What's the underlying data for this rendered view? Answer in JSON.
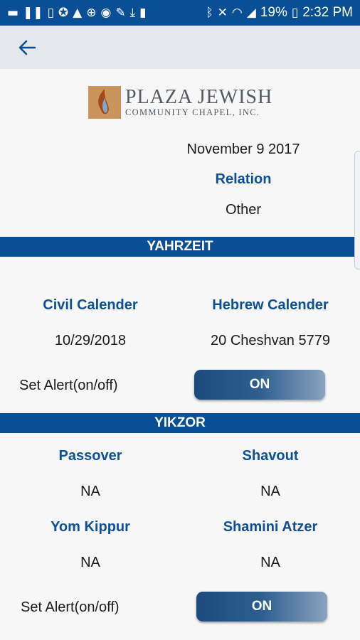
{
  "status_bar": {
    "battery": "19%",
    "time": "2:32 PM"
  },
  "logo": {
    "line1": "PLAZA JEWISH",
    "line2": "COMMUNITY CHAPEL, INC."
  },
  "record": {
    "date": "November 9 2017",
    "relation_label": "Relation",
    "relation_value": "Other"
  },
  "yahrzeit": {
    "header": "YAHRZEIT",
    "civil_label": "Civil Calender",
    "hebrew_label": "Hebrew Calender",
    "civil_date": "10/29/2018",
    "hebrew_date": "20 Cheshvan 5779",
    "alert_label": "Set Alert(on/off)",
    "alert_state": "ON"
  },
  "yikzor": {
    "header": "YIKZOR",
    "passover_label": "Passover",
    "shavout_label": "Shavout",
    "passover_value": "NA",
    "shavout_value": "NA",
    "yom_kippur_label": "Yom Kippur",
    "shamini_label": "Shamini Atzer",
    "yom_kippur_value": "NA",
    "shamini_value": "NA",
    "alert_label": "Set Alert(on/off)",
    "alert_state": "ON"
  },
  "colors": {
    "primary": "#0a4f96",
    "label_blue": "#0e4e9a",
    "app_bar": "#e4e7ec",
    "background": "#f7f7f7"
  }
}
